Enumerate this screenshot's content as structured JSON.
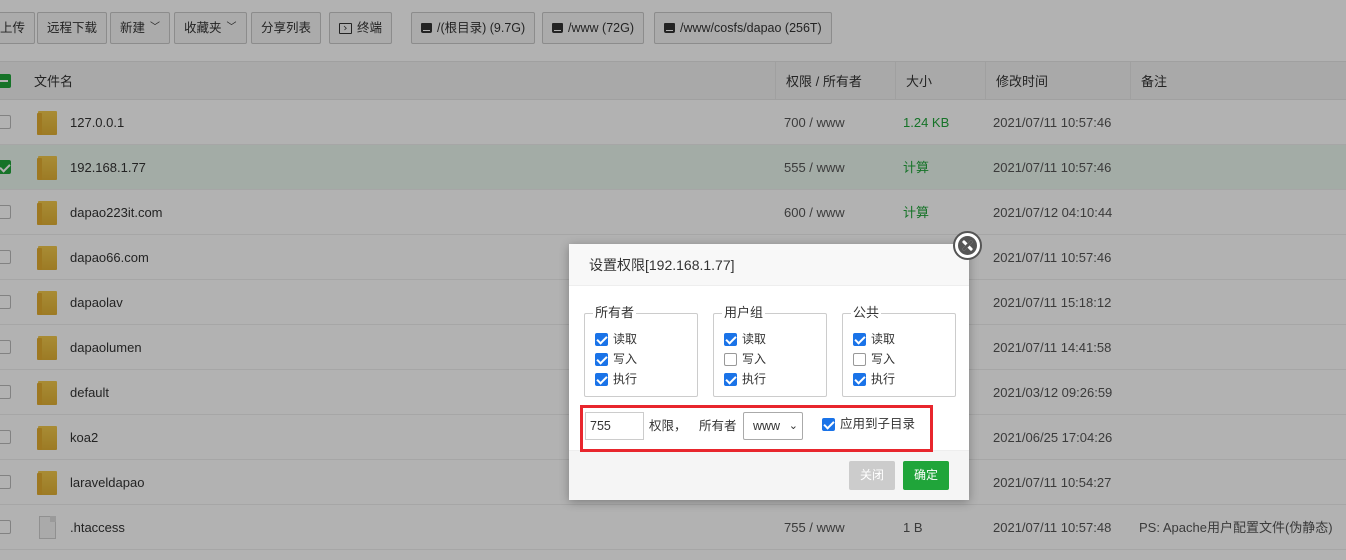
{
  "toolbar": {
    "upload": "上传",
    "remote_download": "远程下载",
    "new": "新建",
    "favorites": "收藏夹",
    "share_list": "分享列表",
    "terminal": "终端",
    "disks": [
      "/(根目录) (9.7G)",
      "/www (72G)",
      "/www/cosfs/dapao (256T)"
    ]
  },
  "table": {
    "headers": {
      "filename": "文件名",
      "perm_owner": "权限 / 所有者",
      "size": "大小",
      "modified": "修改时间",
      "note": "备注"
    },
    "rows": [
      {
        "name": "127.0.0.1",
        "perm": "700 / www",
        "size": "1.24 KB",
        "time": "2021/07/11 10:57:46",
        "note": "",
        "type": "folder",
        "selected": false
      },
      {
        "name": "192.168.1.77",
        "perm": "555 / www",
        "size": "计算",
        "time": "2021/07/11 10:57:46",
        "note": "",
        "type": "folder",
        "selected": true
      },
      {
        "name": "dapao223it.com",
        "perm": "600 / www",
        "size": "计算",
        "time": "2021/07/12 04:10:44",
        "note": "",
        "type": "folder",
        "selected": false
      },
      {
        "name": "dapao66.com",
        "perm": "",
        "size": "",
        "time": "2021/07/11 10:57:46",
        "note": "",
        "type": "folder",
        "selected": false
      },
      {
        "name": "dapaolav",
        "perm": "",
        "size": "",
        "time": "2021/07/11 15:18:12",
        "note": "",
        "type": "folder",
        "selected": false
      },
      {
        "name": "dapaolumen",
        "perm": "",
        "size": "",
        "time": "2021/07/11 14:41:58",
        "note": "",
        "type": "folder",
        "selected": false
      },
      {
        "name": "default",
        "perm": "",
        "size": "",
        "time": "2021/03/12 09:26:59",
        "note": "",
        "type": "folder",
        "selected": false
      },
      {
        "name": "koa2",
        "perm": "",
        "size": "",
        "time": "2021/06/25 17:04:26",
        "note": "",
        "type": "folder",
        "selected": false
      },
      {
        "name": "laraveldapao",
        "perm": "",
        "size": "",
        "time": "2021/07/11 10:54:27",
        "note": "",
        "type": "folder",
        "selected": false
      },
      {
        "name": ".htaccess",
        "perm": "755 / www",
        "size": "1 B",
        "time": "2021/07/11 10:57:48",
        "note": "PS: Apache用户配置文件(伪静态)",
        "type": "file",
        "selected": false
      }
    ]
  },
  "dialog": {
    "title": "设置权限[192.168.1.77]",
    "groups": [
      {
        "name": "所有者",
        "read": "读取",
        "write": "写入",
        "exec": "执行",
        "read_on": true,
        "write_on": true,
        "exec_on": true
      },
      {
        "name": "用户组",
        "read": "读取",
        "write": "写入",
        "exec": "执行",
        "read_on": true,
        "write_on": false,
        "exec_on": true
      },
      {
        "name": "公共",
        "read": "读取",
        "write": "写入",
        "exec": "执行",
        "read_on": true,
        "write_on": false,
        "exec_on": true
      }
    ],
    "perm_value": "755",
    "perm_label": "权限，",
    "owner_label": "所有者",
    "owner_value": "www",
    "apply_sub": "应用到子目录",
    "apply_sub_on": true,
    "cancel": "关闭",
    "ok": "确定"
  },
  "colors": {
    "accent_green": "#20a53a",
    "highlight_red": "#e8262d",
    "checkbox_blue": "#1a73e8"
  }
}
